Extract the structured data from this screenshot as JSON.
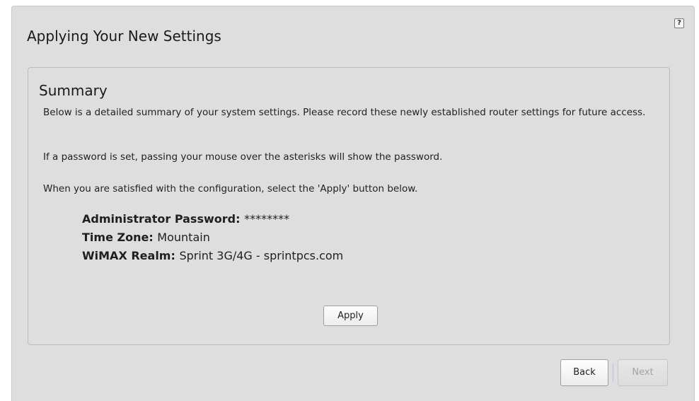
{
  "page": {
    "title": "Applying Your New Settings",
    "help_label": "?"
  },
  "summary": {
    "title": "Summary",
    "paragraphs": [
      "Below is a detailed summary of your system settings. Please record these newly established router settings for future access.",
      "If a password is set, passing your mouse over the asterisks will show the password.",
      "When you are satisfied with the configuration, select the 'Apply' button below."
    ],
    "settings": [
      {
        "label": "Administrator Password:",
        "value": "********"
      },
      {
        "label": "Time Zone:",
        "value": "Mountain"
      },
      {
        "label": "WiMAX Realm:",
        "value": "Sprint 3G/4G - sprintpcs.com"
      }
    ],
    "apply_label": "Apply"
  },
  "navigation": {
    "back_label": "Back",
    "next_label": "Next",
    "next_enabled": false
  }
}
